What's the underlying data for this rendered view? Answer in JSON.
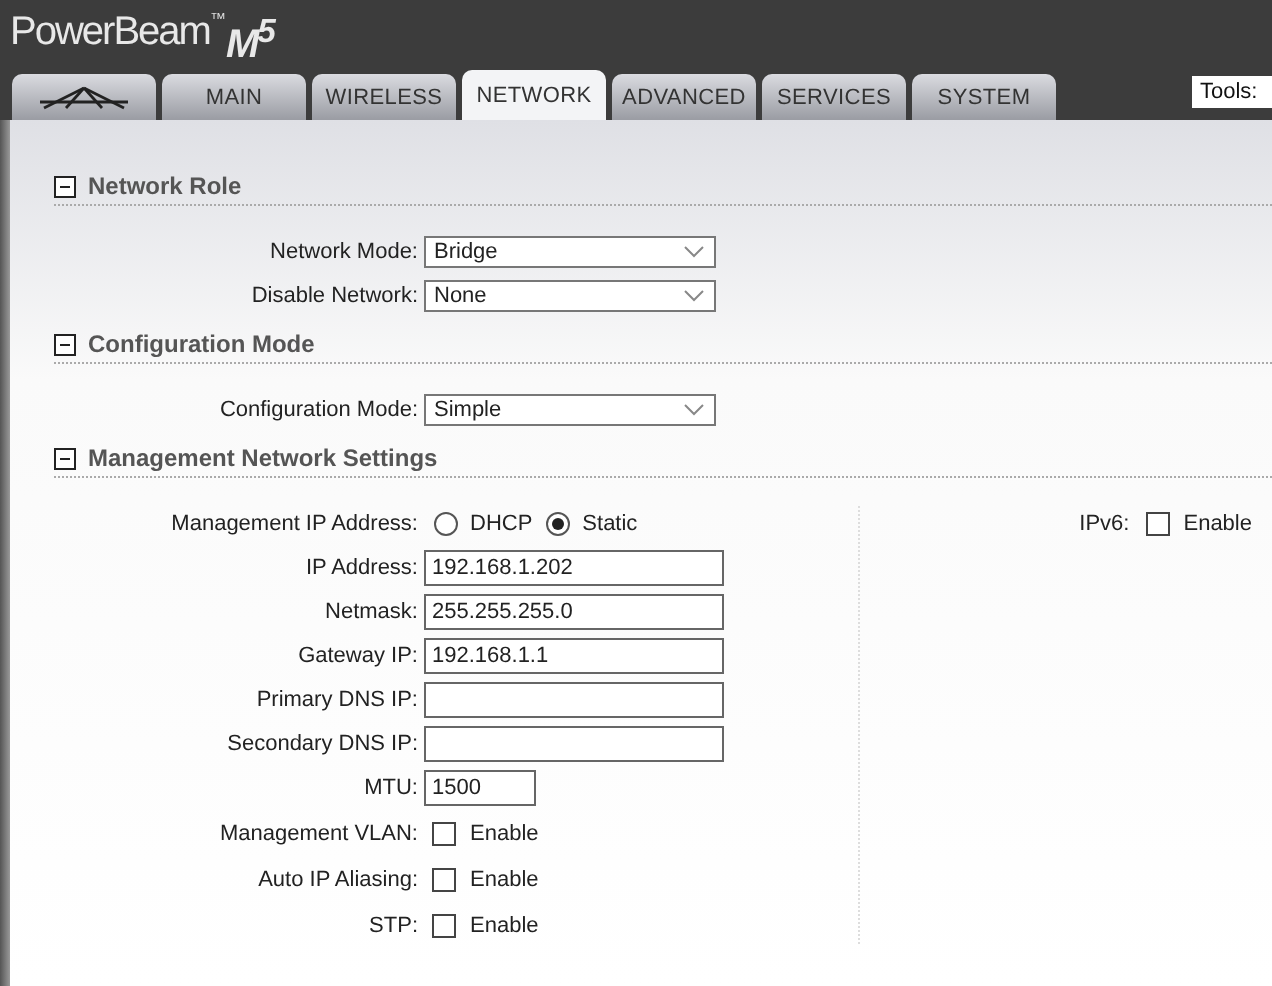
{
  "header": {
    "product": "PowerBeam",
    "trademark": "™",
    "model": "M$^{5}$"
  },
  "tabs": [
    {
      "kind": "logo",
      "selected": false
    },
    {
      "label": "MAIN",
      "selected": false
    },
    {
      "label": "WIRELESS",
      "selected": false
    },
    {
      "label": "NETWORK",
      "selected": true
    },
    {
      "label": "ADVANCED",
      "selected": false
    },
    {
      "label": "SERVICES",
      "selected": false
    },
    {
      "label": "SYSTEM",
      "selected": false
    }
  ],
  "tools": {
    "label": "Tools:"
  },
  "sections": [
    {
      "title": "Network Role",
      "expanded": true,
      "fields": [
        {
          "kind": "select",
          "label": "Network Mode:",
          "value": "Bridge"
        },
        {
          "kind": "select",
          "label": "Disable Network:",
          "value": "None"
        }
      ]
    },
    {
      "title": "Configuration Mode",
      "expanded": true,
      "fields": [
        {
          "kind": "select",
          "label": "Configuration Mode:",
          "value": "Simple"
        }
      ]
    },
    {
      "title": "Management Network Settings",
      "expanded": true,
      "fields": [
        {
          "kind": "radio",
          "label": "Management IP Address:",
          "options": [
            {
              "label": "DHCP",
              "selected": false
            },
            {
              "label": "Static",
              "selected": true
            }
          ]
        },
        {
          "kind": "text",
          "label": "IP Address:",
          "value": "192.168.1.202"
        },
        {
          "kind": "text",
          "label": "Netmask:",
          "value": "255.255.255.0"
        },
        {
          "kind": "text",
          "label": "Gateway IP:",
          "value": "192.168.1.1"
        },
        {
          "kind": "text",
          "label": "Primary DNS IP:"
        },
        {
          "kind": "text",
          "label": "Secondary DNS IP:"
        },
        {
          "kind": "short",
          "label": "MTU:",
          "value": "1500"
        },
        {
          "kind": "checkbox",
          "label": "Management VLAN:",
          "option": "Enable",
          "checked": false
        },
        {
          "kind": "checkbox",
          "label": "Auto IP Aliasing:",
          "option": "Enable",
          "checked": false
        },
        {
          "kind": "checkbox",
          "label": "STP:",
          "option": "Enable",
          "checked": false
        }
      ],
      "side": {
        "label": "IPv6:",
        "option": "Enable",
        "checked": false
      }
    }
  ]
}
